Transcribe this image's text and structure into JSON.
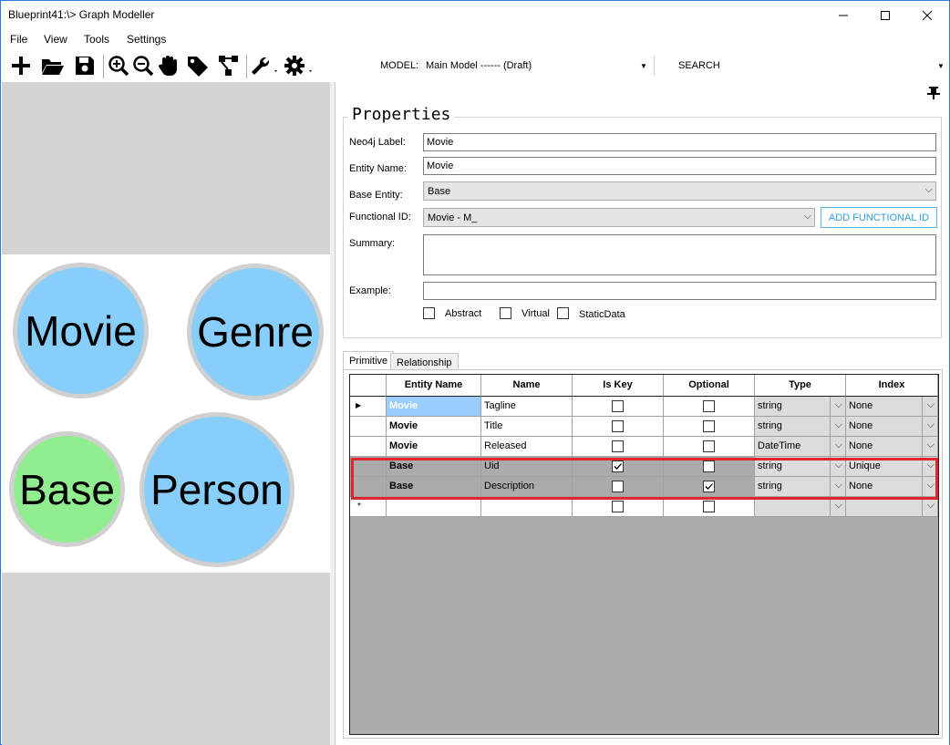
{
  "window": {
    "title": "Blueprint41:\\> Graph Modeller",
    "minimize": "—",
    "maximize": "☐",
    "close": "✕"
  },
  "menu": [
    "File",
    "View",
    "Tools",
    "Settings"
  ],
  "toolbar": {
    "model_label": "MODEL:",
    "model_value": "Main Model ------ (Draft)",
    "search_placeholder": "SEARCH"
  },
  "canvas": {
    "nodes": [
      {
        "label": "Movie",
        "color": "#87cefa"
      },
      {
        "label": "Genre",
        "color": "#87cefa"
      },
      {
        "label": "Base",
        "color": "#90ee90"
      },
      {
        "label": "Person",
        "color": "#87cefa"
      }
    ]
  },
  "properties": {
    "title": "Properties",
    "neo4j_label": "Neo4j Label:",
    "neo4j_value": "Movie",
    "entity_name_label": "Entity Name:",
    "entity_name_value": "Movie",
    "base_entity_label": "Base Entity:",
    "base_entity_value": "Base",
    "functional_id_label": "Functional ID:",
    "functional_id_value": "Movie - M_",
    "add_functional_id": "ADD FUNCTIONAL ID",
    "summary_label": "Summary:",
    "example_label": "Example:",
    "abstract": "Abstract",
    "virtual": "Virtual",
    "static_data": "StaticData"
  },
  "tabs": [
    "Primitive",
    "Relationship"
  ],
  "grid": {
    "columns": [
      "Entity Name",
      "Name",
      "Is Key",
      "Optional",
      "Type",
      "Index"
    ],
    "rows": [
      {
        "entity": "Movie",
        "name": "Tagline",
        "is_key": false,
        "optional": false,
        "type": "string",
        "index": "None"
      },
      {
        "entity": "Movie",
        "name": "Title",
        "is_key": false,
        "optional": false,
        "type": "string",
        "index": "None"
      },
      {
        "entity": "Movie",
        "name": "Released",
        "is_key": false,
        "optional": false,
        "type": "DateTime",
        "index": "None"
      },
      {
        "entity": "Base",
        "name": "Uid",
        "is_key": true,
        "optional": false,
        "type": "string",
        "index": "Unique"
      },
      {
        "entity": "Base",
        "name": "Description",
        "is_key": false,
        "optional": true,
        "type": "string",
        "index": "None"
      }
    ],
    "new_row_marker": "*",
    "current_row_marker": "▶"
  },
  "colors": {
    "highlight": "#e0262c",
    "selected_cell": "#99ccff",
    "add_button": "#2e9fd8"
  }
}
